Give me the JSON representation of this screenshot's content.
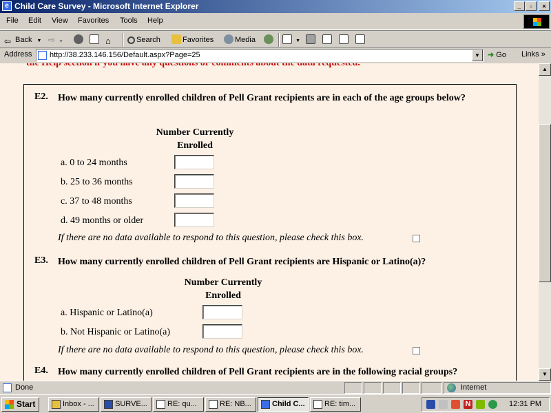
{
  "window": {
    "title": "Child Care Survey - Microsoft Internet Explorer",
    "controls": [
      "_",
      "▫",
      "×"
    ]
  },
  "menubar": {
    "items": [
      "File",
      "Edit",
      "View",
      "Favorites",
      "Tools",
      "Help"
    ]
  },
  "toolbar": {
    "back_label": "Back",
    "search_label": "Search",
    "favorites_label": "Favorites",
    "media_label": "Media"
  },
  "addressbar": {
    "label": "Address",
    "url": "http://38.233.146.156/Default.aspx?Page=25",
    "go_label": "Go",
    "links_label": "Links"
  },
  "page": {
    "top_banner": "the Help section if you have any questions or comments about the data requested.",
    "questions": {
      "e2": {
        "number": "E2.",
        "text": "How many currently enrolled children of Pell Grant recipients are in each of the age groups below?",
        "column_header": "Number Currently Enrolled",
        "rows": [
          "a. 0 to 24 months",
          "b. 25 to 36 months",
          "c. 37 to 48 months",
          "d. 49 months or older"
        ],
        "values": [
          "",
          "",
          "",
          ""
        ],
        "no_data_note": "If there are no data available to respond to this question, please check this box."
      },
      "e3": {
        "number": "E3.",
        "text": "How many currently enrolled children of Pell Grant recipients are Hispanic or Latino(a)?",
        "column_header": "Number Currently Enrolled",
        "rows": [
          "a. Hispanic or Latino(a)",
          "b. Not Hispanic or Latino(a)"
        ],
        "values": [
          "",
          ""
        ],
        "no_data_note": "If there are no data available to respond to this question, please check this box."
      },
      "e4": {
        "number": "E4.",
        "text": "How many currently enrolled children of Pell Grant recipients are in the following racial groups?"
      }
    }
  },
  "statusbar": {
    "status": "Done",
    "zone": "Internet"
  },
  "taskbar": {
    "start_label": "Start",
    "tasks": [
      "Inbox - ...",
      "SURVE...",
      "RE: qu...",
      "RE: NB...",
      "Child C...",
      "RE: tim..."
    ],
    "active_task": 4,
    "clock": "12:31 PM"
  }
}
